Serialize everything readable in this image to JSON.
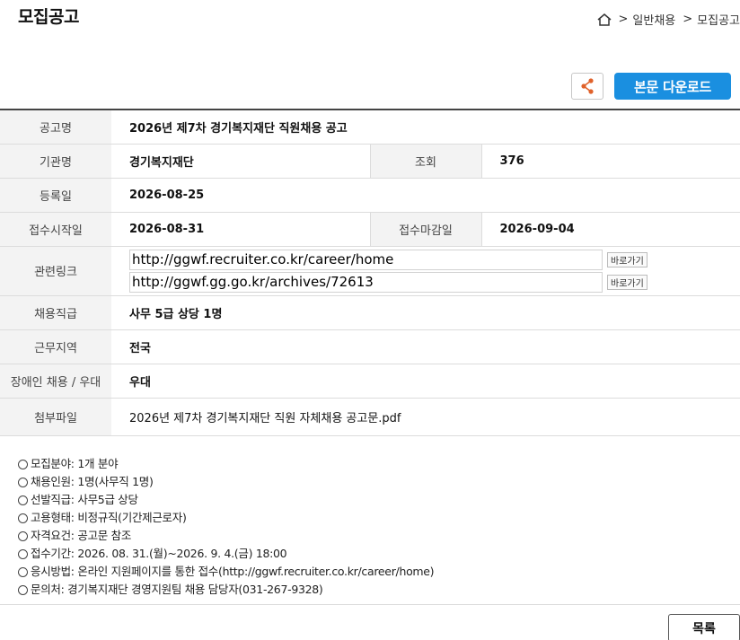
{
  "header": {
    "title": "모집공고",
    "breadcrumb": [
      "일반채용",
      "모집공고"
    ]
  },
  "toolbar": {
    "download_label": "본문 다운로드"
  },
  "table": {
    "labels": {
      "title": "공고명",
      "org": "기관명",
      "views": "조회",
      "registered": "등록일",
      "start": "접수시작일",
      "end": "접수마감일",
      "links": "관련링크",
      "position": "채용직급",
      "region": "근무지역",
      "disability": "장애인 채용 / 우대",
      "attachment": "첨부파일"
    },
    "values": {
      "title": "2026년 제7차 경기복지재단 직원채용 공고",
      "org": "경기복지재단",
      "views": "376",
      "registered": "2026-08-25",
      "start": "2026-08-31",
      "end": "2026-09-04",
      "position": "사무 5급 상당 1명",
      "region": "전국",
      "disability": "우대",
      "attachment": "2026년 제7차 경기복지재단 직원 자체채용 공고문.pdf"
    },
    "links": [
      {
        "url": "http://ggwf.recruiter.co.kr/career/home",
        "go_label": "바로가기"
      },
      {
        "url": "http://ggwf.gg.go.kr/archives/72613",
        "go_label": "바로가기"
      }
    ]
  },
  "notes": [
    "모집분야: 1개 분야",
    "채용인원: 1명(사무직 1명)",
    "선발직급: 사무5급 상당",
    "고용형태: 비정규직(기간제근로자)",
    "자격요건: 공고문 참조",
    "접수기간: 2026. 08. 31.(월)~2026. 9. 4.(금) 18:00",
    "응시방법: 온라인 지원페이지를 통한 접수(http://ggwf.recruiter.co.kr/career/home)",
    "문의처: 경기복지재단 경영지원팀 채용 담당자(031-267-9328)"
  ],
  "footer": {
    "list_label": "목록"
  },
  "colors": {
    "accent": "#1a8fe0",
    "share_icon": "#e0622b"
  }
}
